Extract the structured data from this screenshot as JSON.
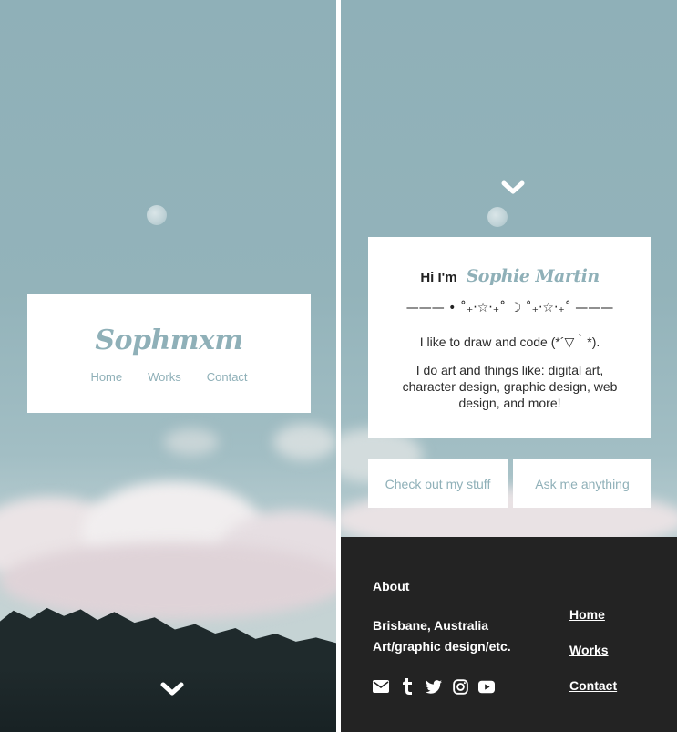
{
  "site": {
    "logo": "Sophmxm",
    "nav": [
      {
        "label": "Home"
      },
      {
        "label": "Works"
      },
      {
        "label": "Contact"
      }
    ]
  },
  "about_card": {
    "greeting": "Hi I'm",
    "name": "Sophie Martin",
    "divider": "——— • ˚₊‧☆‧₊˚ ☽ ˚₊‧☆‧₊˚ ———",
    "tagline": "I like to draw and code (*´▽｀*).",
    "description": "I do art and things like: digital art, character design, graphic design, web design, and more!"
  },
  "cta": {
    "stuff_label": "Check out my stuff",
    "ask_label": "Ask me anything"
  },
  "footer": {
    "heading": "About",
    "location": "Brisbane, Australia",
    "field": "Art/graphic design/etc.",
    "nav": [
      {
        "label": "Home"
      },
      {
        "label": "Works"
      },
      {
        "label": "Contact"
      }
    ],
    "social_icons": [
      "envelope-icon",
      "tumblr-icon",
      "twitter-icon",
      "instagram-icon",
      "youtube-icon"
    ]
  },
  "colors": {
    "accent": "#8fb0b8",
    "footer_bg": "#232323",
    "card_bg": "#ffffff",
    "text": "#2b2b2b"
  }
}
